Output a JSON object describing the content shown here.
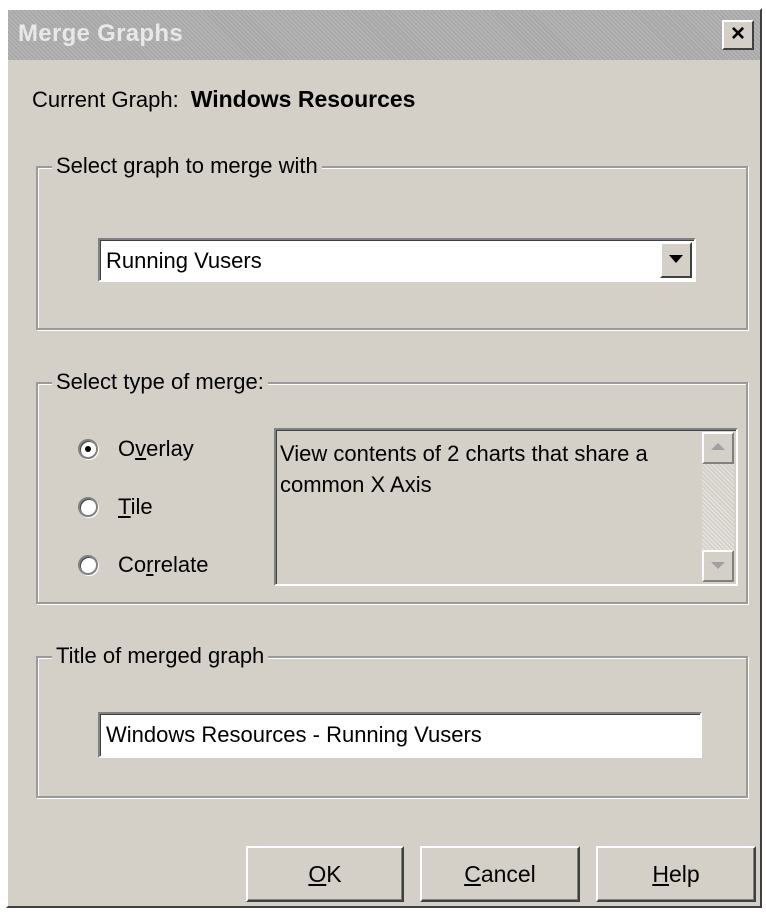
{
  "window": {
    "title": "Merge Graphs",
    "close_label": "×"
  },
  "current_graph": {
    "label": "Current Graph:",
    "value": "Windows Resources"
  },
  "select_graph": {
    "legend": "Select graph to merge with",
    "selected": "Running Vusers"
  },
  "merge_type": {
    "legend": "Select type of merge:",
    "options": [
      {
        "pre": "O",
        "accel": "v",
        "post": "erlay",
        "checked": true
      },
      {
        "pre": "",
        "accel": "T",
        "post": "ile",
        "checked": false
      },
      {
        "pre": "Co",
        "accel": "r",
        "post": "relate",
        "checked": false
      }
    ],
    "description": "View contents of 2 charts that share a common X Axis"
  },
  "merged_title": {
    "legend": "Title of merged graph",
    "value": "Windows Resources - Running Vusers"
  },
  "buttons": {
    "ok": {
      "accel": "O",
      "rest": "K"
    },
    "cancel": {
      "accel": "C",
      "rest": "ancel"
    },
    "help": {
      "accel": "H",
      "rest": "elp"
    }
  }
}
